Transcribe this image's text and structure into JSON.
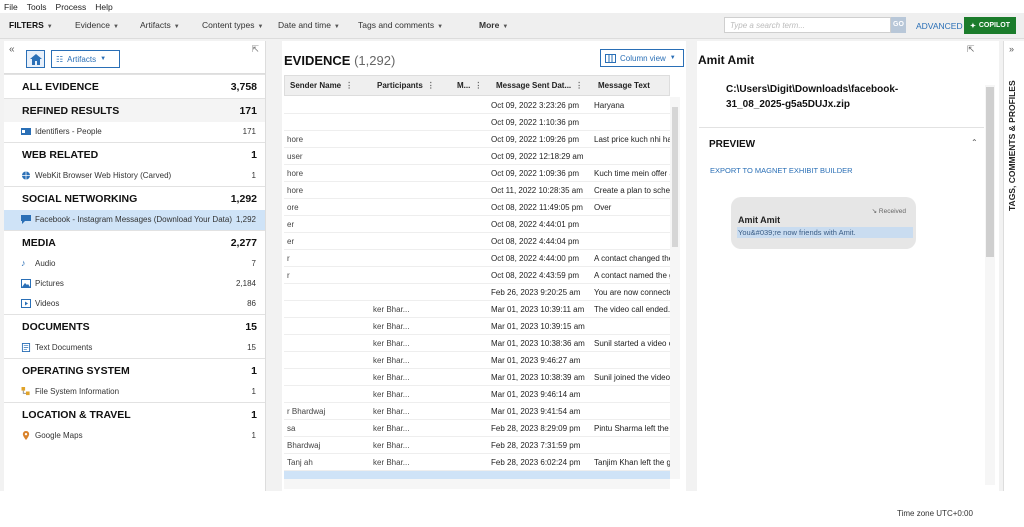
{
  "menu": [
    "File",
    "Tools",
    "Process",
    "Help"
  ],
  "filters": {
    "label": "FILTERS",
    "items": [
      "Evidence",
      "Artifacts",
      "Content types",
      "Date and time",
      "Tags and comments",
      "More"
    ],
    "search_placeholder": "Type a search term...",
    "go": "GO",
    "advanced": "ADVANCED",
    "copilot": "COPILOT"
  },
  "left": {
    "artifacts_btn": "Artifacts",
    "categories": [
      {
        "name": "ALL EVIDENCE",
        "count": "3,758",
        "subs": []
      },
      {
        "name": "REFINED RESULTS",
        "count": "171",
        "subs": [
          {
            "name": "Identifiers - People",
            "count": "171",
            "icon": "id-card-icon"
          }
        ]
      },
      {
        "name": "WEB RELATED",
        "count": "1",
        "subs": [
          {
            "name": "WebKit Browser Web History (Carved)",
            "count": "1",
            "icon": "globe-icon"
          }
        ]
      },
      {
        "name": "SOCIAL NETWORKING",
        "count": "1,292",
        "subs": [
          {
            "name": "Facebook - Instagram Messages (Download Your Data)",
            "count": "1,292",
            "icon": "chat-icon"
          }
        ]
      },
      {
        "name": "MEDIA",
        "count": "2,277",
        "subs": [
          {
            "name": "Audio",
            "count": "7",
            "icon": "audio-icon"
          },
          {
            "name": "Pictures",
            "count": "2,184",
            "icon": "picture-icon"
          },
          {
            "name": "Videos",
            "count": "86",
            "icon": "video-icon"
          }
        ]
      },
      {
        "name": "DOCUMENTS",
        "count": "15",
        "subs": [
          {
            "name": "Text Documents",
            "count": "15",
            "icon": "document-icon"
          }
        ]
      },
      {
        "name": "OPERATING SYSTEM",
        "count": "1",
        "subs": [
          {
            "name": "File System Information",
            "count": "1",
            "icon": "folder-icon"
          }
        ]
      },
      {
        "name": "LOCATION & TRAVEL",
        "count": "1",
        "subs": [
          {
            "name": "Google Maps",
            "count": "1",
            "icon": "map-pin-icon"
          }
        ]
      }
    ]
  },
  "evidence": {
    "title": "EVIDENCE",
    "count": "(1,292)",
    "column_view": "Column view",
    "columns": [
      "Sender Name",
      "Participants",
      "M...",
      "Message Sent Dat...",
      "Message Text"
    ],
    "rows": [
      {
        "sender": "",
        "participants": "",
        "date": "Oct 09, 2022 3:23:26 pm",
        "text": "Haryana"
      },
      {
        "sender": "",
        "participants": "",
        "date": "Oct 09, 2022 1:10:36 pm",
        "text": ""
      },
      {
        "sender": "hore",
        "participants": "",
        "date": "Oct 09, 2022 1:09:26 pm",
        "text": "Last price kuch nhi hai"
      },
      {
        "sender": "user",
        "participants": "",
        "date": "Oct 09, 2022 12:18:29 am",
        "text": ""
      },
      {
        "sender": "hore",
        "participants": "",
        "date": "Oct 09, 2022 1:09:36 pm",
        "text": "Kuch time mein offer a"
      },
      {
        "sender": "hore",
        "participants": "",
        "date": "Oct 11, 2022 10:28:35 am",
        "text": "Create a plan to sched"
      },
      {
        "sender": "ore",
        "participants": "",
        "date": "Oct 08, 2022 11:49:05 pm",
        "text": "Over"
      },
      {
        "sender": "er",
        "participants": "",
        "date": "Oct 08, 2022 4:44:01 pm",
        "text": ""
      },
      {
        "sender": "er",
        "participants": "",
        "date": "Oct 08, 2022 4:44:04 pm",
        "text": ""
      },
      {
        "sender": "r",
        "participants": "",
        "date": "Oct 08, 2022 4:44:00 pm",
        "text": "A contact changed the"
      },
      {
        "sender": "r",
        "participants": "",
        "date": "Oct 08, 2022 4:43:59 pm",
        "text": "A contact named the g"
      },
      {
        "sender": "",
        "participants": "",
        "date": "Feb 26, 2023 9:20:25 am",
        "text": "You are now connecte"
      },
      {
        "sender": "",
        "participants": "ker Bhar...",
        "date": "Mar 01, 2023 10:39:11 am",
        "text": "The video call ended."
      },
      {
        "sender": "",
        "participants": "ker Bhar...",
        "date": "Mar 01, 2023 10:39:15 am",
        "text": ""
      },
      {
        "sender": "",
        "participants": "ker Bhar...",
        "date": "Mar 01, 2023 10:38:36 am",
        "text": "Sunil started a video c"
      },
      {
        "sender": "",
        "participants": "ker Bhar...",
        "date": "Mar 01, 2023 9:46:27 am",
        "text": ""
      },
      {
        "sender": "",
        "participants": "ker Bhar...",
        "date": "Mar 01, 2023 10:38:39 am",
        "text": "Sunil joined the video"
      },
      {
        "sender": "",
        "participants": "ker Bhar...",
        "date": "Mar 01, 2023 9:46:14 am",
        "text": ""
      },
      {
        "sender": "r Bhardwaj",
        "participants": "ker Bhar...",
        "date": "Mar 01, 2023 9:41:54 am",
        "text": ""
      },
      {
        "sender": "sa",
        "participants": "ker Bhar...",
        "date": "Feb 28, 2023 8:29:09 pm",
        "text": "Pintu Sharma left the g"
      },
      {
        "sender": "Bhardwaj",
        "participants": "ker Bhar...",
        "date": "Feb 28, 2023 7:31:59 pm",
        "text": ""
      },
      {
        "sender": "Tanj  ah",
        "participants": "ker Bhar...",
        "date": "Feb 28, 2023 6:02:24 pm",
        "text": "Tanjim Khan left the gr"
      },
      {
        "sender": "",
        "participants": "",
        "date": "",
        "text": ""
      }
    ]
  },
  "detail": {
    "title": "Amit Amit",
    "path_line1": "C:\\Users\\Digit\\Downloads\\facebook-",
    "path_line2": "31_08_2025-g5a5DUJx.zip",
    "preview": "PREVIEW",
    "export": "EXPORT TO MAGNET EXHIBIT BUILDER",
    "received": "Received",
    "bubble_sender": "Amit Amit",
    "bubble_message": "You&#039;re now friends with Amit."
  },
  "vtab": "TAGS, COMMENTS & PROFILES",
  "status": {
    "timezone": "Time zone   UTC+0:00"
  }
}
